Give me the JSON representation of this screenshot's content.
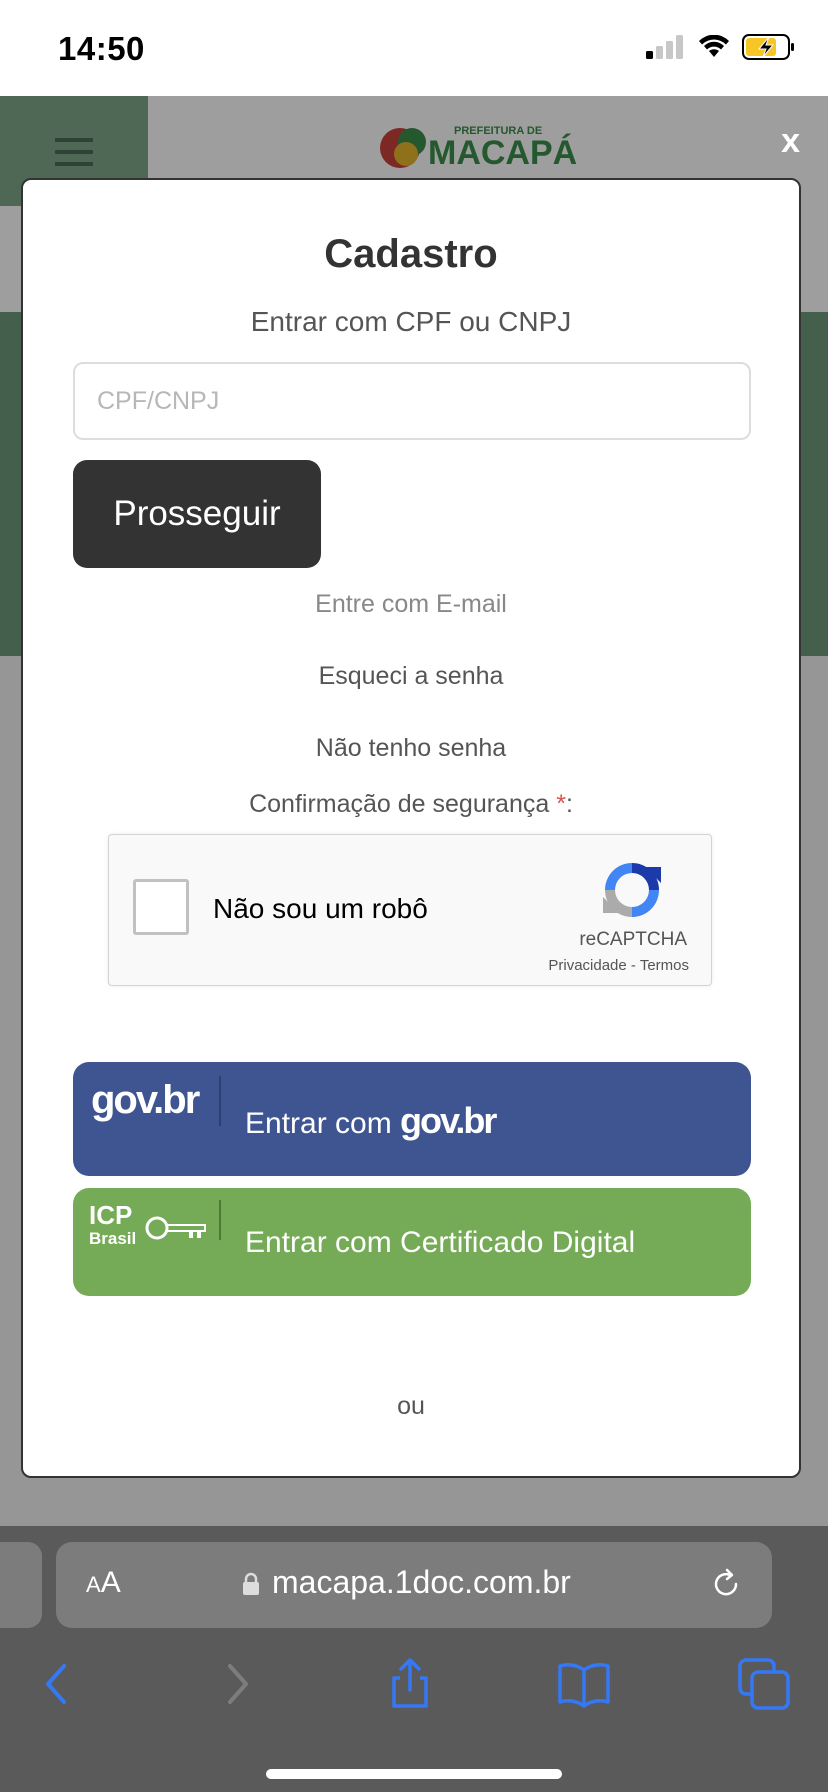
{
  "status_bar": {
    "time": "14:50"
  },
  "background_page": {
    "logo_small_text": "PREFEITURA DE",
    "logo_text": "MACAPÁ",
    "close_label": "x"
  },
  "modal": {
    "title": "Cadastro",
    "subtitle": "Entrar com CPF ou CNPJ",
    "cpf_input": {
      "placeholder": "CPF/CNPJ",
      "value": ""
    },
    "proceed_label": "Prosseguir",
    "email_link": "Entre com E-mail",
    "forgot_link": "Esqueci a senha",
    "no_password_link": "Não tenho senha",
    "security_label": "Confirmação de segurança",
    "required_marker": "*",
    "security_colon": ":",
    "recaptcha": {
      "label": "Não sou um robô",
      "brand": "reCAPTCHA",
      "privacy": "Privacidade",
      "separator": " - ",
      "terms": "Termos"
    },
    "govbr_button": {
      "logo": "gov.br",
      "text_prefix": "Entrar com ",
      "text_brand": "gov.br"
    },
    "icp_button": {
      "logo_top": "ICP",
      "logo_bottom": "Brasil",
      "text": "Entrar com Certificado Digital"
    },
    "or_label": "ou"
  },
  "browser": {
    "text_size_label_small": "A",
    "text_size_label_large": "A",
    "url": "macapa.1doc.com.br"
  },
  "colors": {
    "gov_blue": "#3f5592",
    "icp_green": "#75ab56",
    "dark_button": "#333333",
    "required_red": "#d9534f",
    "ios_blue": "#3478f6"
  }
}
